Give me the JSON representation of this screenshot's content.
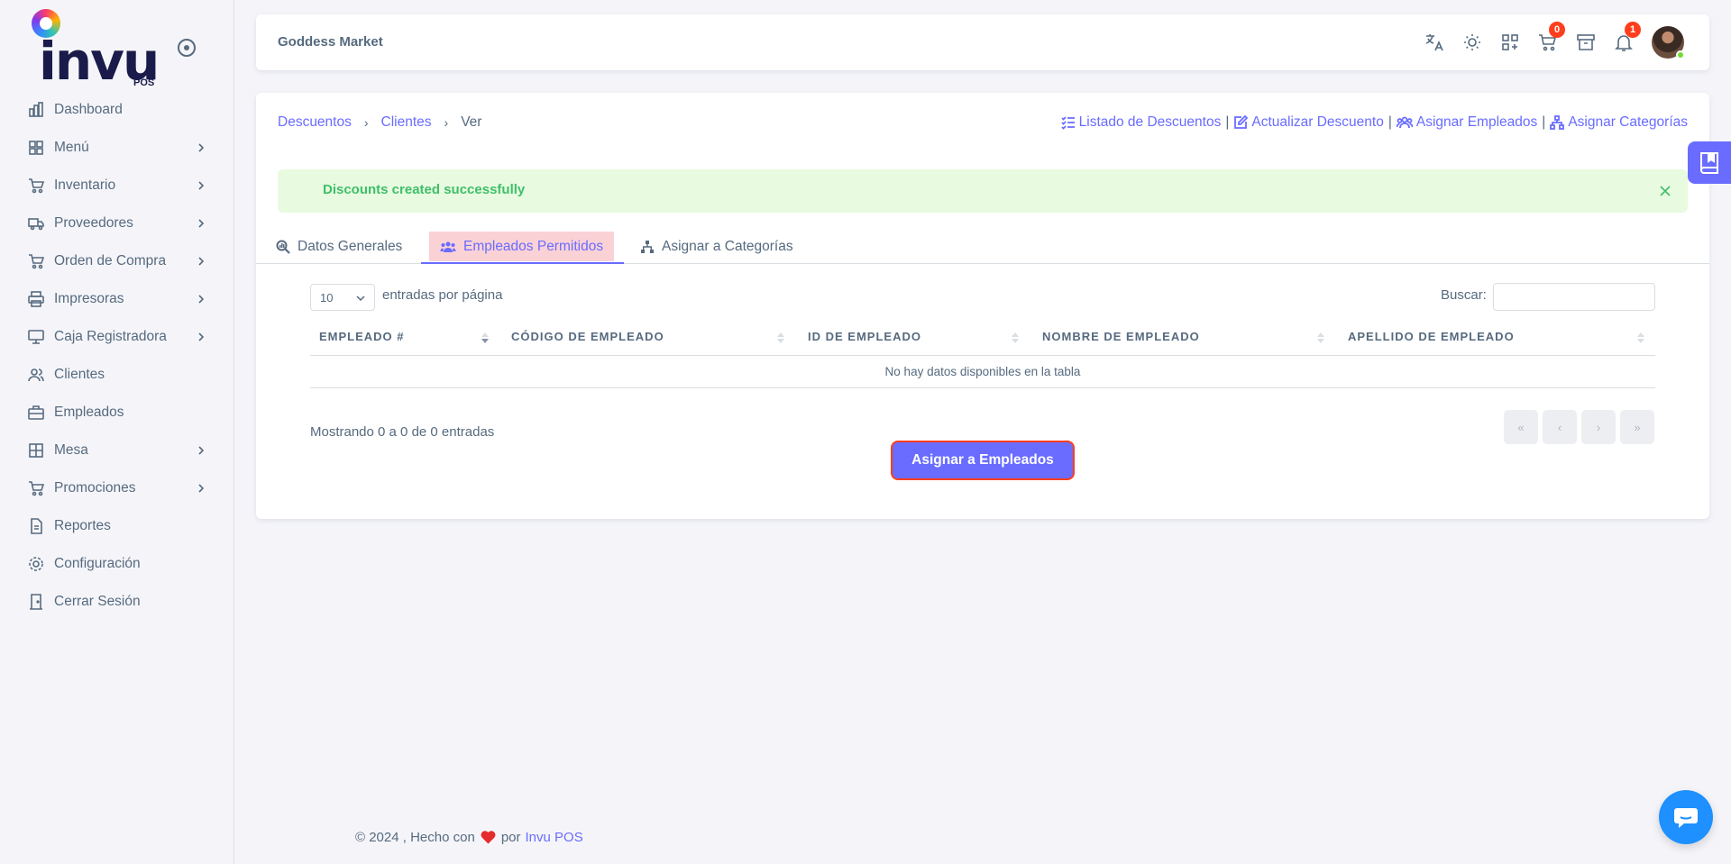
{
  "brand": {
    "logo_text": "invu",
    "logo_sub": "POS"
  },
  "sidebar": {
    "items": [
      {
        "label": "Dashboard",
        "icon": "bar-chart-icon",
        "has_children": false
      },
      {
        "label": "Menú",
        "icon": "grid-icon",
        "has_children": true
      },
      {
        "label": "Inventario",
        "icon": "cart-icon",
        "has_children": true
      },
      {
        "label": "Proveedores",
        "icon": "truck-icon",
        "has_children": true
      },
      {
        "label": "Orden de Compra",
        "icon": "shopping-cart-icon",
        "has_children": true
      },
      {
        "label": "Impresoras",
        "icon": "printer-icon",
        "has_children": true
      },
      {
        "label": "Caja Registradora",
        "icon": "register-icon",
        "has_children": true
      },
      {
        "label": "Clientes",
        "icon": "users-icon",
        "has_children": false
      },
      {
        "label": "Empleados",
        "icon": "briefcase-icon",
        "has_children": false
      },
      {
        "label": "Mesa",
        "icon": "table-icon",
        "has_children": true
      },
      {
        "label": "Promociones",
        "icon": "cart-icon",
        "has_children": true
      },
      {
        "label": "Reportes",
        "icon": "document-icon",
        "has_children": false
      },
      {
        "label": "Configuración",
        "icon": "gear-icon",
        "has_children": false
      },
      {
        "label": "Cerrar Sesión",
        "icon": "door-icon",
        "has_children": false
      }
    ]
  },
  "navbar": {
    "store_name": "Goddess Market",
    "cart_count": "0",
    "notification_count": "1"
  },
  "breadcrumb": {
    "item1": "Descuentos",
    "item2": "Clientes",
    "current": "Ver"
  },
  "actions": {
    "list": "Listado de Descuentos",
    "update": "Actualizar Descuento",
    "assign_employees": "Asignar Empleados",
    "assign_categories": "Asignar Categorías",
    "separator": "|"
  },
  "alert": {
    "message": "Discounts created successfully"
  },
  "tabs": [
    {
      "label": "Datos Generales",
      "active": false
    },
    {
      "label": "Empleados Permitidos",
      "active": true
    },
    {
      "label": "Asignar a Categorías",
      "active": false
    }
  ],
  "table_controls": {
    "page_length": "10",
    "page_length_label": "entradas por página",
    "search_label": "Buscar:",
    "search_value": ""
  },
  "table": {
    "columns": [
      "EMPLEADO #",
      "CÓDIGO DE EMPLEADO",
      "ID DE EMPLEADO",
      "NOMBRE DE EMPLEADO",
      "APELLIDO DE EMPLEADO"
    ],
    "empty_message": "No hay datos disponibles en la tabla"
  },
  "pagination": {
    "info": "Mostrando 0 a 0 de 0 entradas",
    "first": "«",
    "prev": "‹",
    "next": "›",
    "last": "»"
  },
  "assign_button": "Asignar a Empleados",
  "footer": {
    "text": "© 2024 , Hecho con",
    "by": "por",
    "link": "Invu POS"
  },
  "colors": {
    "primary": "#696cff",
    "danger": "#ff3e1d",
    "success": "#71dd37",
    "alert_bg": "#e8fadf"
  }
}
